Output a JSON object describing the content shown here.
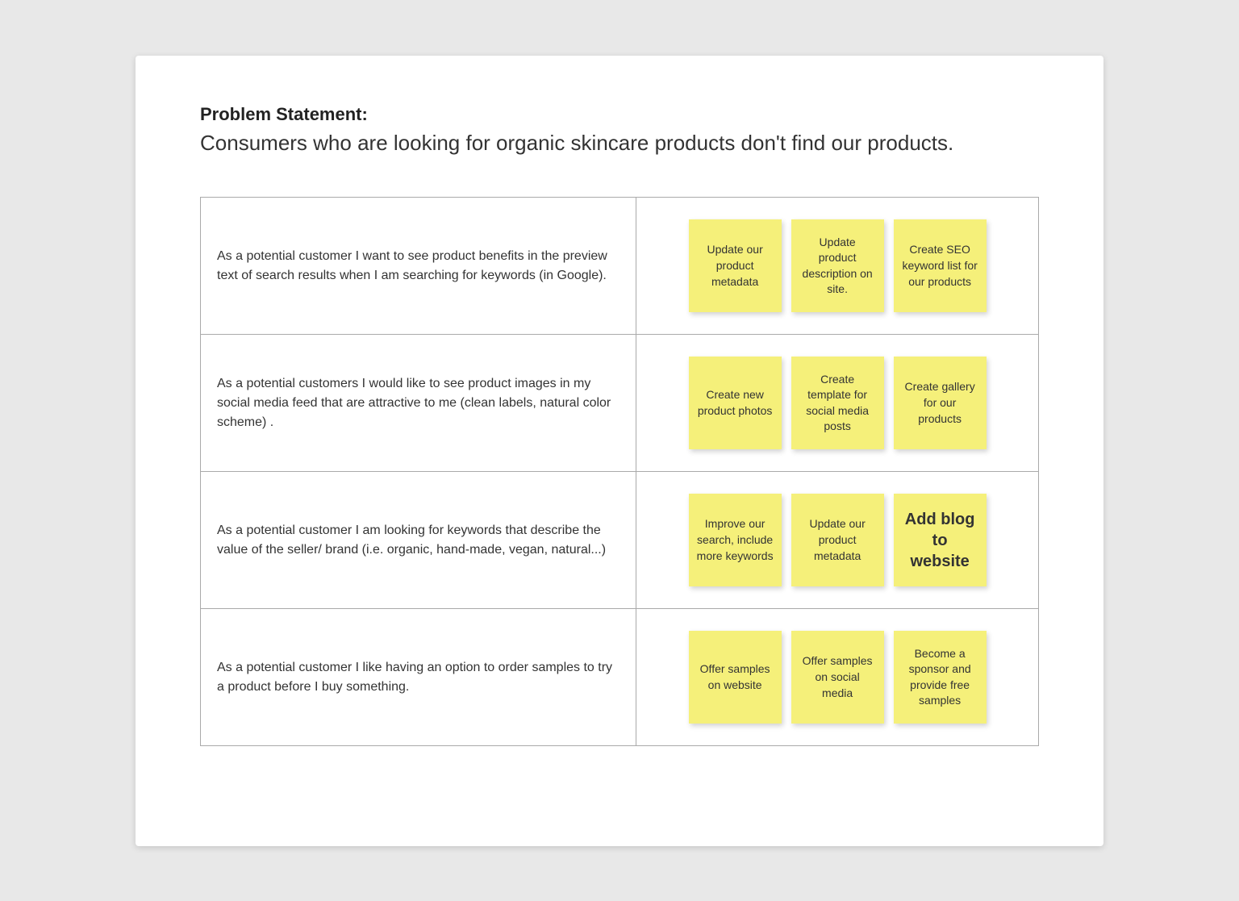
{
  "header": {
    "problem_label": "Problem Statement:",
    "problem_text": "Consumers who are looking for organic skincare products don't find our products."
  },
  "rows": [
    {
      "id": "row1",
      "user_story": "As a potential customer I want to see product benefits in the preview text of search results when I am searching for keywords (in Google).",
      "sticky_notes": [
        {
          "id": "note1a",
          "text": "Update our product metadata",
          "large": false
        },
        {
          "id": "note1b",
          "text": "Update product description on site.",
          "large": false
        },
        {
          "id": "note1c",
          "text": "Create SEO keyword list for our products",
          "large": false
        }
      ]
    },
    {
      "id": "row2",
      "user_story": "As a potential customers I would like to see product images in my social media feed that are attractive to me (clean labels, natural color scheme) .",
      "sticky_notes": [
        {
          "id": "note2a",
          "text": "Create new product photos",
          "large": false
        },
        {
          "id": "note2b",
          "text": "Create template for social media posts",
          "large": false
        },
        {
          "id": "note2c",
          "text": "Create gallery for our products",
          "large": false
        }
      ]
    },
    {
      "id": "row3",
      "user_story": "As a potential customer I am looking for keywords that describe the value of the seller/ brand (i.e. organic, hand-made, vegan, natural...)",
      "sticky_notes": [
        {
          "id": "note3a",
          "text": "Improve our search, include more keywords",
          "large": false
        },
        {
          "id": "note3b",
          "text": "Update our product metadata",
          "large": false
        },
        {
          "id": "note3c",
          "text": "Add blog to website",
          "large": true
        }
      ]
    },
    {
      "id": "row4",
      "user_story": "As a potential customer I like having an option to order samples to try a product before I buy something.",
      "sticky_notes": [
        {
          "id": "note4a",
          "text": "Offer samples on website",
          "large": false
        },
        {
          "id": "note4b",
          "text": "Offer samples on social media",
          "large": false
        },
        {
          "id": "note4c",
          "text": "Become a sponsor and provide free samples",
          "large": false
        }
      ]
    }
  ]
}
